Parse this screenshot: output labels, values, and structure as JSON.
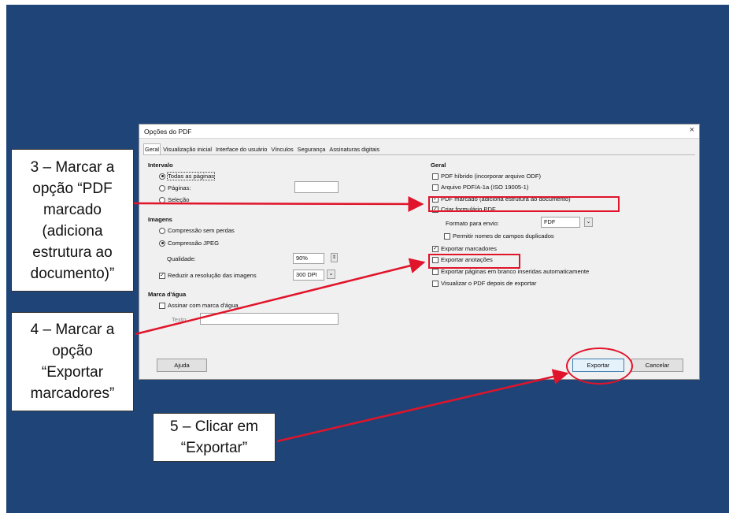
{
  "dialog": {
    "title": "Opções do PDF",
    "close_glyph": "×",
    "tabs": [
      "Geral",
      "Visualização inicial",
      "Interface do usuário",
      "Vínculos",
      "Segurança",
      "Assinaturas digitais"
    ],
    "intervalo": {
      "heading": "Intervalo",
      "todas": "Todas as páginas",
      "paginas": "Páginas:",
      "selecao": "Seleção"
    },
    "imagem": {
      "heading": "Imagens",
      "sem_perdas": "Compressão sem perdas",
      "jpeg": "Compressão JPEG",
      "qualidade_label": "Qualidade:",
      "qualidade_value": "90%",
      "reduzir": "Reduzir a resolução das imagens",
      "dpi_value": "300 DPI"
    },
    "marca": {
      "heading": "Marca d'água",
      "assinar": "Assinar com marca d'água",
      "texto_label": "Texto:"
    },
    "geral": {
      "heading": "Geral",
      "hibrido": "PDF híbrido (incorporar arquivo ODF)",
      "pdfa": "Arquivo PDF/A-1a (ISO 19005-1)",
      "marcado": "PDF marcado (adiciona estrutura ao documento)",
      "formulario": "Criar formulário PDF",
      "formato_label": "Formato para envio:",
      "formato_value": "FDF",
      "permitir": "Permitir nomes de campos duplicados",
      "exportar_marcadores": "Exportar marcadores",
      "exportar_anotacoes": "Exportar anotações",
      "exportar_branco": "Exportar páginas em branco inseridas automaticamente",
      "visualizar": "Visualizar o PDF depois de exportar"
    },
    "buttons": {
      "ajuda": "Ajuda",
      "exportar": "Exportar",
      "cancelar": "Cancelar"
    }
  },
  "callouts": {
    "c3": [
      "3 – Marcar a",
      "opção “PDF",
      "marcado",
      "(adiciona",
      "estrutura ao",
      "documento)”"
    ],
    "c4": [
      "4 – Marcar a",
      "opção",
      "“Exportar",
      "marcadores”"
    ],
    "c5": [
      "5 – Clicar em",
      "“Exportar”"
    ]
  },
  "colors": {
    "slide_background": "#1f4578",
    "highlight": "#e0142a",
    "dialog_background": "#f0f0f0"
  }
}
